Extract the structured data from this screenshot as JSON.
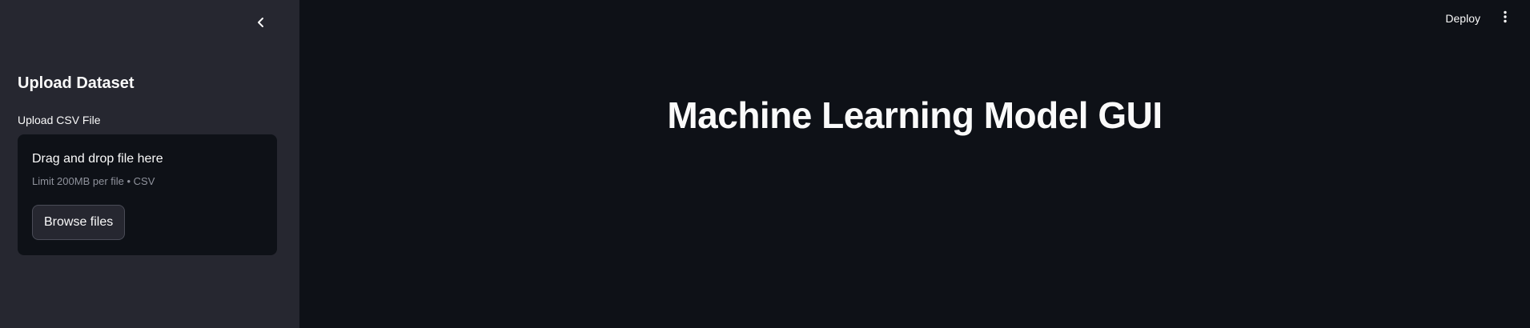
{
  "sidebar": {
    "heading": "Upload Dataset",
    "uploader": {
      "label": "Upload CSV File",
      "drop_text": "Drag and drop file here",
      "limit_text": "Limit 200MB per file • CSV",
      "browse_label": "Browse files"
    }
  },
  "header": {
    "deploy_label": "Deploy"
  },
  "main": {
    "title": "Machine Learning Model GUI"
  },
  "colors": {
    "sidebar_bg": "#262730",
    "main_bg": "#0e1117",
    "text": "#fafafa",
    "muted_text": "#8f929c"
  },
  "icons": {
    "collapse": "chevron-left-icon",
    "menu": "more-vertical-icon"
  }
}
